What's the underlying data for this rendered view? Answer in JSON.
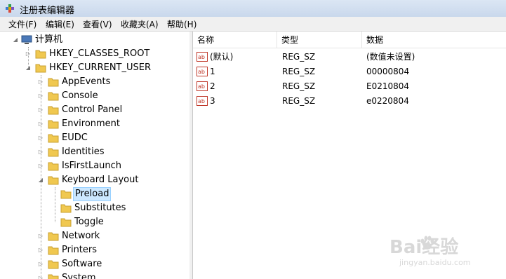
{
  "window": {
    "title": "注册表编辑器",
    "icon": "regedit-icon"
  },
  "menu": [
    "文件(F)",
    "编辑(E)",
    "查看(V)",
    "收藏夹(A)",
    "帮助(H)"
  ],
  "tree": {
    "root": "计算机",
    "hives": [
      "HKEY_CLASSES_ROOT",
      "HKEY_CURRENT_USER"
    ],
    "hkcu_children": [
      "AppEvents",
      "Console",
      "Control Panel",
      "Environment",
      "EUDC",
      "Identities",
      "IsFirstLaunch",
      "Keyboard Layout"
    ],
    "keyboard_layout_children": [
      "Preload",
      "Substitutes",
      "Toggle"
    ],
    "more_children": [
      "Network",
      "Printers",
      "Software",
      "System"
    ],
    "selected": "Preload"
  },
  "list": {
    "columns": [
      "名称",
      "类型",
      "数据"
    ],
    "rows": [
      {
        "name": "(默认)",
        "type": "REG_SZ",
        "data": "(数值未设置)"
      },
      {
        "name": "1",
        "type": "REG_SZ",
        "data": "00000804"
      },
      {
        "name": "2",
        "type": "REG_SZ",
        "data": "E0210804"
      },
      {
        "name": "3",
        "type": "REG_SZ",
        "data": "e0220804"
      }
    ]
  },
  "watermark": {
    "brand": "Bai经验",
    "url": "jingyan.baidu.com"
  }
}
